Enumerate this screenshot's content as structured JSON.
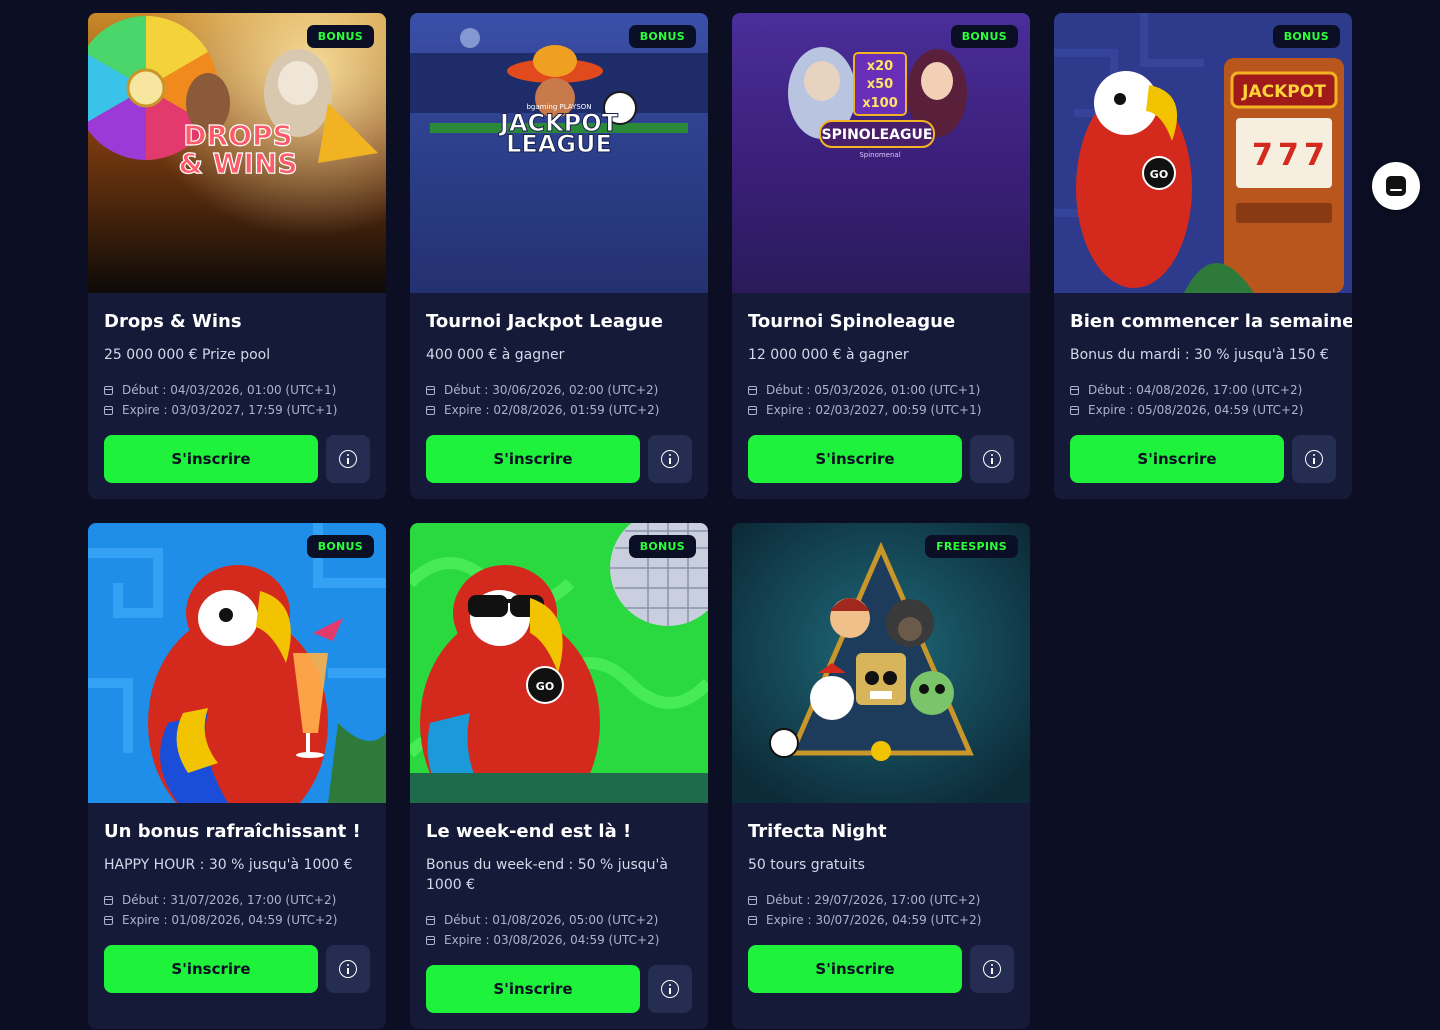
{
  "cards": [
    {
      "badge": "BONUS",
      "art": "drops-wins",
      "art_title": "DROPS & WINS",
      "title": "Drops & Wins",
      "subtitle": "25 000 000 € Prize pool",
      "start": "Début : 04/03/2026, 01:00 (UTC+1)",
      "expire": "Expire : 03/03/2027, 17:59 (UTC+1)",
      "cta": "S'inscrire"
    },
    {
      "badge": "BONUS",
      "art": "jackpot-league",
      "art_title": "JACKPOT LEAGUE",
      "art_small": "bgaming  PLAYSON",
      "title": "Tournoi Jackpot League",
      "subtitle": "400 000 € à gagner",
      "start": "Début : 30/06/2026, 02:00 (UTC+2)",
      "expire": "Expire : 02/08/2026, 01:59 (UTC+2)",
      "cta": "S'inscrire"
    },
    {
      "badge": "BONUS",
      "art": "spinoleague",
      "art_title": "SPINOLEAGUE",
      "art_small": "Spinomenal",
      "multipliers": [
        "x20",
        "x50",
        "x100"
      ],
      "title": "Tournoi Spinoleague",
      "subtitle": "12 000 000 € à gagner",
      "start": "Début : 05/03/2026, 01:00 (UTC+1)",
      "expire": "Expire : 02/03/2027, 00:59 (UTC+1)",
      "cta": "S'inscrire"
    },
    {
      "badge": "BONUS",
      "art": "parrot-jackpot",
      "art_title": "JACKPOT",
      "chip": "GO",
      "title": "Bien commencer la semaine",
      "subtitle": "Bonus du mardi : 30 % jusqu'à 150 €",
      "start": "Début : 04/08/2026, 17:00 (UTC+2)",
      "expire": "Expire : 05/08/2026, 04:59 (UTC+2)",
      "cta": "S'inscrire"
    },
    {
      "badge": "BONUS",
      "art": "parrot-cocktail",
      "title": "Un bonus rafraîchissant !",
      "subtitle": "HAPPY HOUR : 30 % jusqu'à 1000 €",
      "start": "Début : 31/07/2026, 17:00 (UTC+2)",
      "expire": "Expire : 01/08/2026, 04:59 (UTC+2)",
      "cta": "S'inscrire"
    },
    {
      "badge": "BONUS",
      "art": "parrot-disco",
      "chip": "GO",
      "title": "Le week-end est là !",
      "subtitle": "Bonus du week-end : 50 % jusqu'à 1000 €",
      "start": "Début : 01/08/2026, 05:00 (UTC+2)",
      "expire": "Expire : 03/08/2026, 04:59 (UTC+2)",
      "cta": "S'inscrire"
    },
    {
      "badge": "FREESPINS",
      "art": "trifecta",
      "title": "Trifecta Night",
      "subtitle": "50 tours gratuits",
      "start": "Début : 29/07/2026, 17:00 (UTC+2)",
      "expire": "Expire : 30/07/2026, 04:59 (UTC+2)",
      "cta": "S'inscrire"
    }
  ],
  "colors": {
    "background": "#0c0f24",
    "card": "#141a38",
    "accent_green": "#1ef23b",
    "badge_text": "#2cff3a"
  },
  "chat_launcher": {
    "icon": "chat-icon"
  }
}
